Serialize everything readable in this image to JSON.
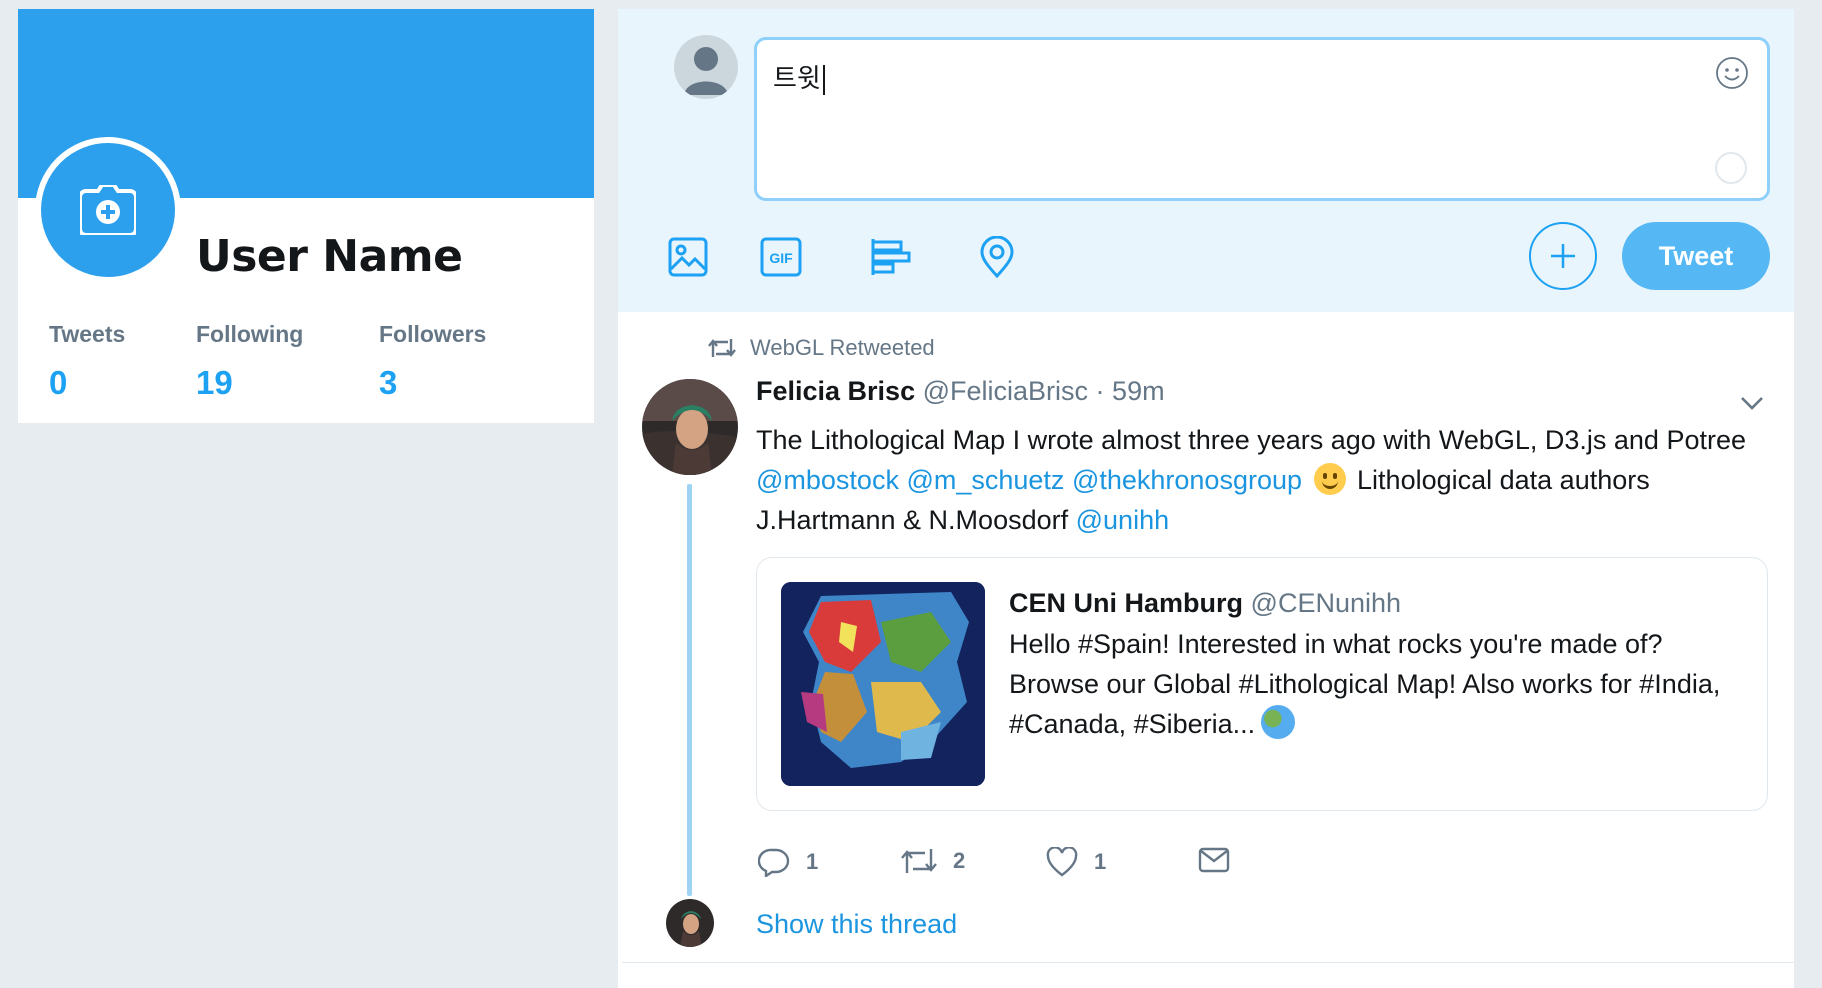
{
  "profile": {
    "user_name": "User Name",
    "stats": [
      {
        "label": "Tweets",
        "value": "0"
      },
      {
        "label": "Following",
        "value": "19"
      },
      {
        "label": "Followers",
        "value": "3"
      }
    ],
    "avatar_icon": "camera-add-icon",
    "banner_color": "#2ca0ec"
  },
  "composer": {
    "text": "트윗",
    "emoji_icon": "smiley-icon",
    "tools": [
      "image-icon",
      "gif-icon",
      "poll-icon",
      "location-icon"
    ],
    "gif_label": "GIF",
    "add_icon": "plus-icon",
    "tweet_label": "Tweet",
    "accent_color": "#1da1f2"
  },
  "tweet": {
    "retweet_note": "WebGL Retweeted",
    "author_name": "Felicia Brisc",
    "author_handle": "@FeliciaBrisc",
    "separator": " · ",
    "time": "59m",
    "text_parts": {
      "p1": "The Lithological Map I wrote almost three years ago with WebGL, D3.js and Potree ",
      "m1": "@mbostock",
      "m2": "@m_schuetz",
      "m3": "@thekhronosgroup",
      "p2": " Lithological data authors J.Hartmann & N.Moosdorf ",
      "m4": "@unihh"
    },
    "quote": {
      "name": "CEN Uni Hamburg",
      "handle": "@CENunihh",
      "text": "Hello #Spain! Interested in what rocks you're made of? Browse our Global #Lithological Map! Also works for #India, #Canada, #Siberia..."
    },
    "actions": {
      "reply_count": "1",
      "retweet_count": "2",
      "like_count": "1"
    },
    "show_thread": "Show this thread"
  }
}
